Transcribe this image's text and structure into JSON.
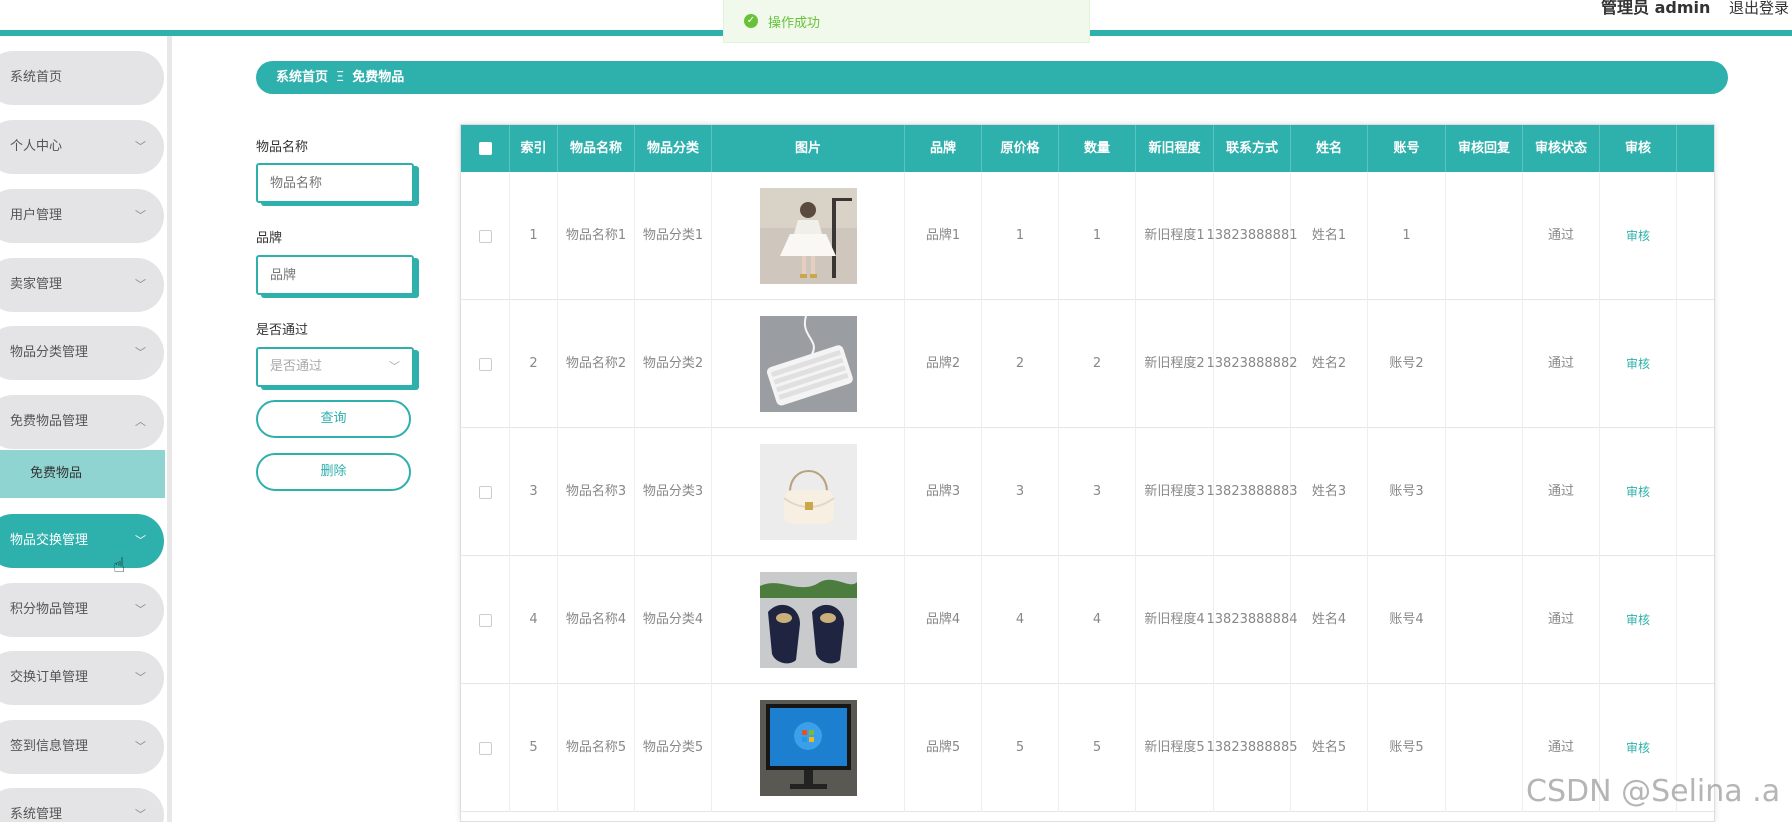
{
  "header": {
    "admin_label": "管理员 admin",
    "logout": "退出登录"
  },
  "toast": {
    "message": "操作成功"
  },
  "sidebar": {
    "items": [
      {
        "label": "系统首页"
      },
      {
        "label": "个人中心"
      },
      {
        "label": "用户管理"
      },
      {
        "label": "卖家管理"
      },
      {
        "label": "物品分类管理"
      },
      {
        "label": "免费物品管理"
      },
      {
        "label": "物品交换管理"
      },
      {
        "label": "积分物品管理"
      },
      {
        "label": "交换订单管理"
      },
      {
        "label": "签到信息管理"
      },
      {
        "label": "系统管理"
      }
    ],
    "subitem": "免费物品"
  },
  "breadcrumb": {
    "home": "系统首页",
    "separator": "Ξ",
    "current": "免费物品"
  },
  "search": {
    "name_label": "物品名称",
    "name_placeholder": "物品名称",
    "brand_label": "品牌",
    "brand_placeholder": "品牌",
    "pass_label": "是否通过",
    "pass_placeholder": "是否通过",
    "query_button": "查询",
    "delete_button": "删除"
  },
  "table": {
    "headers": [
      "索引",
      "物品名称",
      "物品分类",
      "图片",
      "品牌",
      "原价格",
      "数量",
      "新旧程度",
      "联系方式",
      "姓名",
      "账号",
      "审核回复",
      "审核状态",
      "审核"
    ],
    "rows": [
      {
        "index": "1",
        "name": "物品名称1",
        "category": "物品分类1",
        "image": "dress",
        "brand": "品牌1",
        "price": "1",
        "qty": "1",
        "condition": "新旧程度1",
        "contact": "13823888881",
        "person": "姓名1",
        "account": "1",
        "reply": "",
        "status": "通过",
        "action": "审核"
      },
      {
        "index": "2",
        "name": "物品名称2",
        "category": "物品分类2",
        "image": "keyboard",
        "brand": "品牌2",
        "price": "2",
        "qty": "2",
        "condition": "新旧程度2",
        "contact": "13823888882",
        "person": "姓名2",
        "account": "账号2",
        "reply": "",
        "status": "通过",
        "action": "审核"
      },
      {
        "index": "3",
        "name": "物品名称3",
        "category": "物品分类3",
        "image": "handbag",
        "brand": "品牌3",
        "price": "3",
        "qty": "3",
        "condition": "新旧程度3",
        "contact": "13823888883",
        "person": "姓名3",
        "account": "账号3",
        "reply": "",
        "status": "通过",
        "action": "审核"
      },
      {
        "index": "4",
        "name": "物品名称4",
        "category": "物品分类4",
        "image": "shoes",
        "brand": "品牌4",
        "price": "4",
        "qty": "4",
        "condition": "新旧程度4",
        "contact": "13823888884",
        "person": "姓名4",
        "account": "账号4",
        "reply": "",
        "status": "通过",
        "action": "审核"
      },
      {
        "index": "5",
        "name": "物品名称5",
        "category": "物品分类5",
        "image": "monitor",
        "brand": "品牌5",
        "price": "5",
        "qty": "5",
        "condition": "新旧程度5",
        "contact": "13823888885",
        "person": "姓名5",
        "account": "账号5",
        "reply": "",
        "status": "通过",
        "action": "审核"
      }
    ]
  },
  "watermark": "CSDN @Selina .a",
  "colors": {
    "accent": "#2eb0ac",
    "success": "#67c23a"
  }
}
